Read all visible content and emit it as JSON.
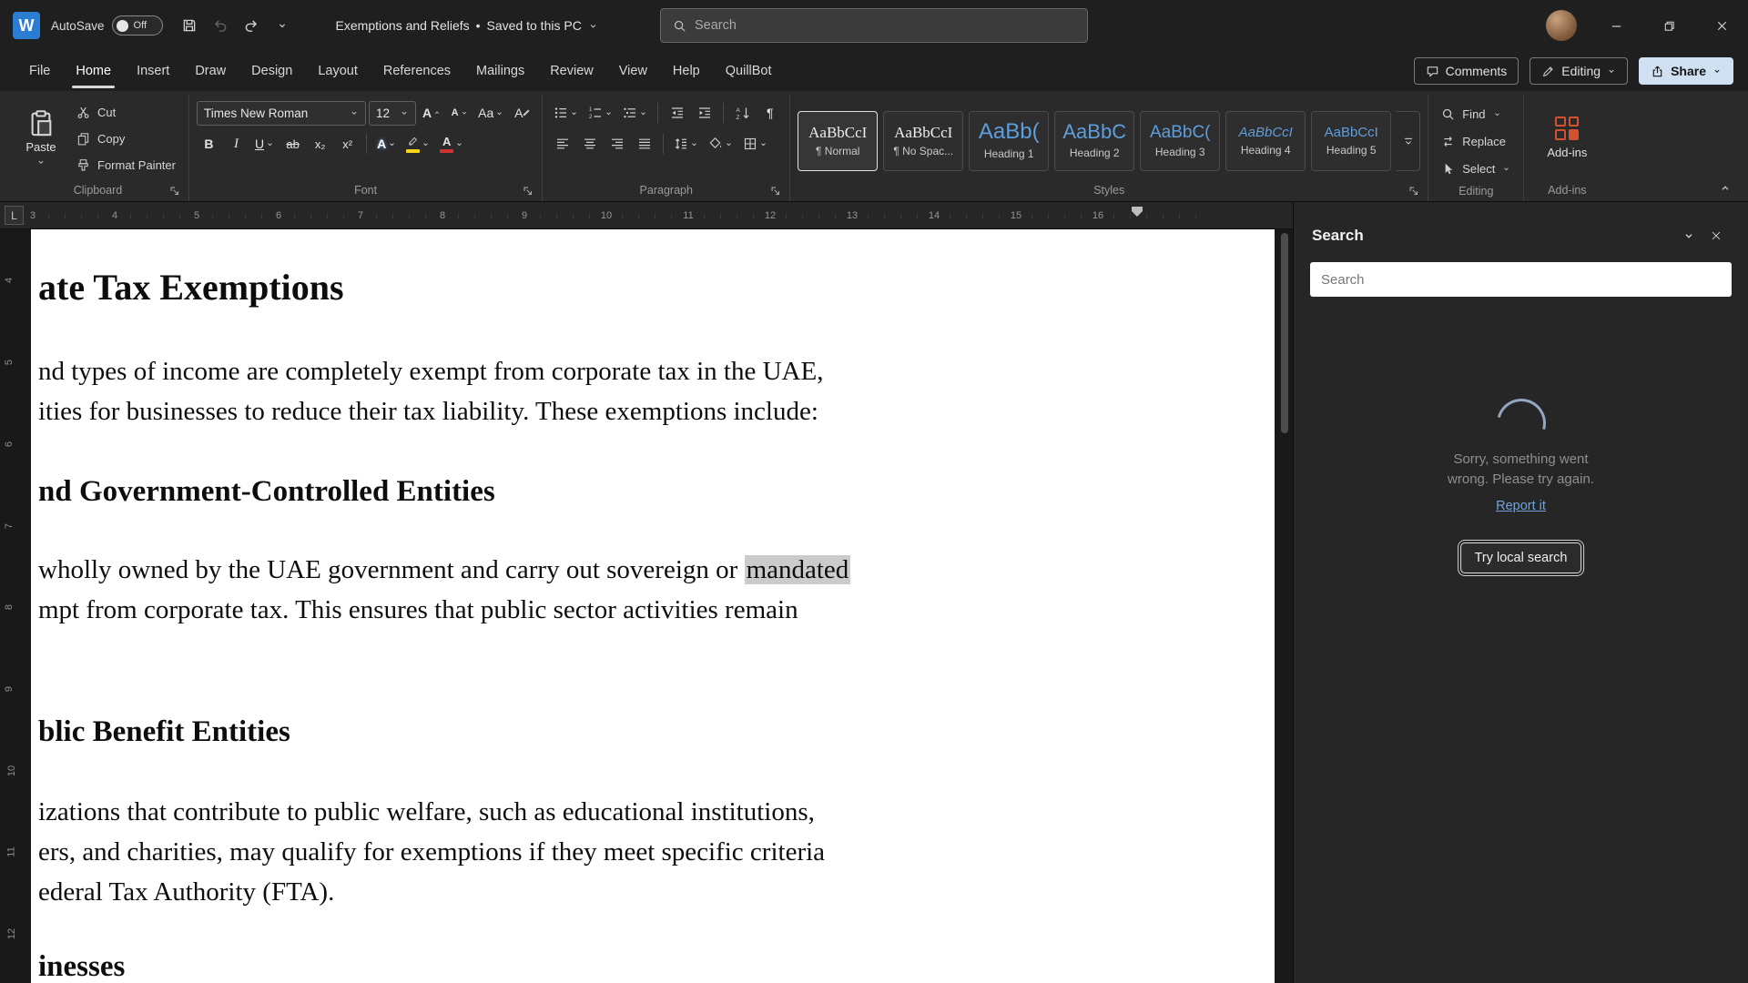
{
  "titlebar": {
    "autosave_label": "AutoSave",
    "autosave_state": "Off",
    "doc_title": "Exemptions and Reliefs",
    "title_separator": "•",
    "doc_status": "Saved to this PC",
    "search_placeholder": "Search"
  },
  "menubar": {
    "items": [
      "File",
      "Home",
      "Insert",
      "Draw",
      "Design",
      "Layout",
      "References",
      "Mailings",
      "Review",
      "View",
      "Help",
      "QuillBot"
    ],
    "comments": "Comments",
    "editing": "Editing",
    "share": "Share"
  },
  "ribbon": {
    "clipboard": {
      "paste": "Paste",
      "cut": "Cut",
      "copy": "Copy",
      "format_painter": "Format Painter",
      "label": "Clipboard"
    },
    "font": {
      "family": "Times New Roman",
      "size": "12",
      "grow": "A",
      "shrink": "A",
      "case": "Aa",
      "clear": "A",
      "bold": "B",
      "italic": "I",
      "underline": "U",
      "strike": "ab",
      "subscript": "x₂",
      "superscript": "x²",
      "effects": "A",
      "color": "A",
      "label": "Font"
    },
    "paragraph": {
      "pilcrow": "¶",
      "label": "Paragraph"
    },
    "styles": {
      "label": "Styles",
      "items": [
        {
          "preview": "AaBbCcI",
          "name": "¶ Normal"
        },
        {
          "preview": "AaBbCcI",
          "name": "¶ No Spac..."
        },
        {
          "preview": "AaBb(",
          "name": "Heading 1"
        },
        {
          "preview": "AaBbC",
          "name": "Heading 2"
        },
        {
          "preview": "AaBbC(",
          "name": "Heading 3"
        },
        {
          "preview": "AaBbCcI",
          "name": "Heading 4"
        },
        {
          "preview": "AaBbCcI",
          "name": "Heading 5"
        }
      ]
    },
    "editing": {
      "find": "Find",
      "replace": "Replace",
      "select": "Select",
      "label": "Editing"
    },
    "addins": {
      "button_label": "Add-ins",
      "label": "Add-ins"
    }
  },
  "ruler": {
    "tab_selector": "L",
    "h": [
      "3",
      "4",
      "5",
      "6",
      "7",
      "8",
      "9",
      "10",
      "11",
      "12",
      "13",
      "14",
      "15",
      "16"
    ],
    "v": [
      "4",
      "5",
      "6",
      "7",
      "8",
      "9",
      "10",
      "11",
      "12"
    ]
  },
  "document": {
    "h1": "ate Tax Exemptions",
    "p1a": "nd types of income are completely exempt from corporate tax in the UAE,",
    "p1b": "ities for businesses to reduce their tax liability. These exemptions include:",
    "h2": "nd Government-Controlled Entities",
    "p2a_pre": "wholly owned by the UAE government and carry out sovereign or ",
    "p2a_hl": "mandated",
    "p2b": "mpt from corporate tax. This ensures that public sector activities remain",
    "h3": "blic Benefit Entities",
    "p3a": "izations that contribute to public welfare, such as educational institutions,",
    "p3b": "ers, and charities, may qualify for exemptions if they meet specific criteria",
    "p3c": "ederal Tax Authority (FTA).",
    "h4": "inesses"
  },
  "pane": {
    "title": "Search",
    "search_placeholder": "Search",
    "error_line1": "Sorry, something went",
    "error_line2": "wrong. Please try again.",
    "report_link": "Report it",
    "local_button": "Try local search"
  }
}
